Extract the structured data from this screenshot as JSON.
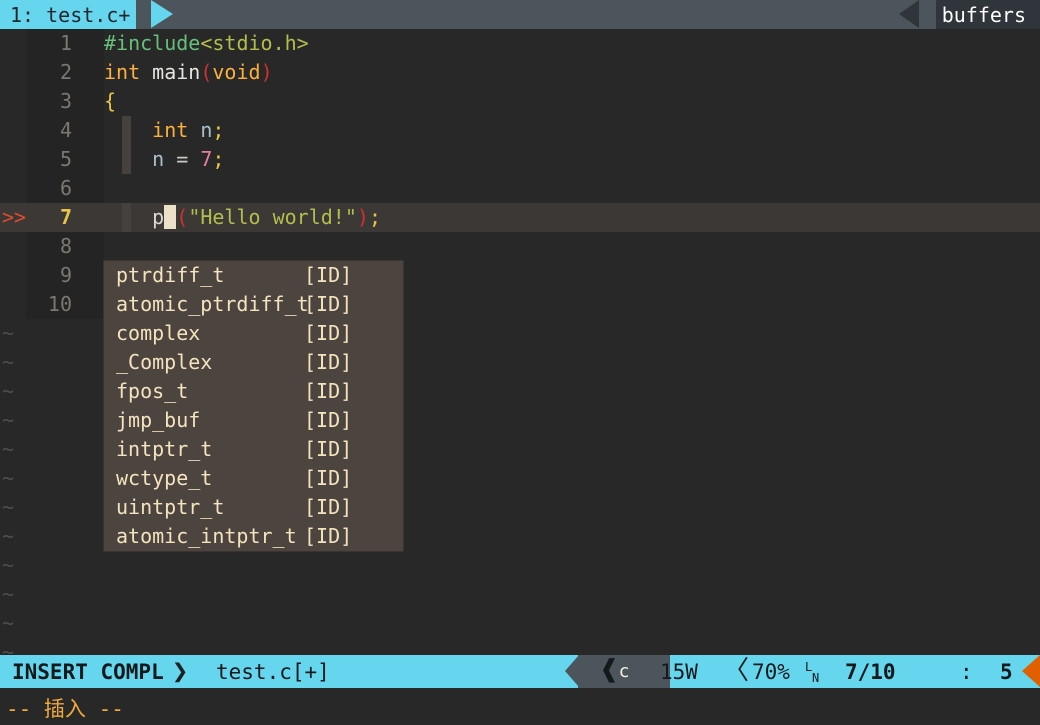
{
  "tabline": {
    "active_tab": "1: test.c+",
    "right_label": "buffers",
    "tab_bg": "#65d6ed",
    "bar_bg": "#4c555b"
  },
  "editor": {
    "lines": [
      {
        "num": "1",
        "sign": "",
        "indent_bar": false,
        "tokens": [
          {
            "t": "#include",
            "c": "c-pre"
          },
          {
            "t": "<stdio.h>",
            "c": "c-inc"
          }
        ]
      },
      {
        "num": "2",
        "sign": "",
        "indent_bar": false,
        "tokens": [
          {
            "t": "int",
            "c": "c-kw"
          },
          {
            "t": " ",
            "c": "c-ident"
          },
          {
            "t": "main",
            "c": "c-fn"
          },
          {
            "t": "(",
            "c": "c-paren"
          },
          {
            "t": "void",
            "c": "c-kw"
          },
          {
            "t": ")",
            "c": "c-paren"
          }
        ]
      },
      {
        "num": "3",
        "sign": "",
        "indent_bar": false,
        "tokens": [
          {
            "t": "{",
            "c": "c-brace"
          }
        ]
      },
      {
        "num": "4",
        "sign": "",
        "indent_bar": true,
        "tokens": [
          {
            "t": "    ",
            "c": "c-ident"
          },
          {
            "t": "int",
            "c": "c-kw"
          },
          {
            "t": " ",
            "c": "c-ident"
          },
          {
            "t": "n",
            "c": "c-var"
          },
          {
            "t": ";",
            "c": "c-punct"
          }
        ]
      },
      {
        "num": "5",
        "sign": "",
        "indent_bar": true,
        "tokens": [
          {
            "t": "    ",
            "c": "c-ident"
          },
          {
            "t": "n",
            "c": "c-var"
          },
          {
            "t": " ",
            "c": "c-ident"
          },
          {
            "t": "=",
            "c": "c-op"
          },
          {
            "t": " ",
            "c": "c-ident"
          },
          {
            "t": "7",
            "c": "c-num"
          },
          {
            "t": ";",
            "c": "c-punct"
          }
        ]
      },
      {
        "num": "6",
        "sign": "",
        "indent_bar": false,
        "tokens": []
      },
      {
        "num": "7",
        "sign": ">>",
        "cursorline": true,
        "indent_bar": true,
        "tokens": [
          {
            "t": "    ",
            "c": "c-ident"
          },
          {
            "t": "p",
            "c": "c-ident spellbad"
          },
          {
            "t": " ",
            "c": "cursorblock"
          },
          {
            "t": "(",
            "c": "c-paren"
          },
          {
            "t": "\"Hello world!\"",
            "c": "c-str"
          },
          {
            "t": ")",
            "c": "c-paren"
          },
          {
            "t": ";",
            "c": "c-punct"
          }
        ]
      },
      {
        "num": "8",
        "sign": "",
        "indent_bar": false,
        "tokens": []
      },
      {
        "num": "9",
        "sign": "",
        "indent_bar": true,
        "tokens": []
      },
      {
        "num": "10",
        "sign": "",
        "indent_bar": false,
        "tokens": [
          {
            "t": "}",
            "c": "c-brace"
          }
        ]
      }
    ],
    "empty_marker": "~",
    "empty_marker_count": 12
  },
  "popup": {
    "items": [
      {
        "word": "ptrdiff_t",
        "kind": "[ID]"
      },
      {
        "word": "atomic_ptrdiff_t",
        "kind": "[ID]"
      },
      {
        "word": "complex",
        "kind": "[ID]"
      },
      {
        "word": "_Complex",
        "kind": "[ID]"
      },
      {
        "word": "fpos_t",
        "kind": "[ID]"
      },
      {
        "word": "jmp_buf",
        "kind": "[ID]"
      },
      {
        "word": "intptr_t",
        "kind": "[ID]"
      },
      {
        "word": "wctype_t",
        "kind": "[ID]"
      },
      {
        "word": "uintptr_t",
        "kind": "[ID]"
      },
      {
        "word": "atomic_intptr_t",
        "kind": "[ID]"
      }
    ],
    "bg": "#4c443f",
    "fg": "#f4e3be"
  },
  "statusline": {
    "mode": "INSERT COMPL",
    "separator": "❯",
    "filename": "test.c[+]",
    "filetype": "c",
    "encoding_width": "15W",
    "thin_chevron": "〈",
    "percent": "70%",
    "ln_glyph_top": "L",
    "ln_glyph_bottom": "N",
    "position": "7/10",
    "colon": ":",
    "column": "5",
    "bg": "#65d6ed",
    "mid_bg": "#4c555b",
    "right_arrow_color": "#e06000"
  },
  "message": {
    "text": "-- 插入 --",
    "color": "#f0a93a"
  }
}
